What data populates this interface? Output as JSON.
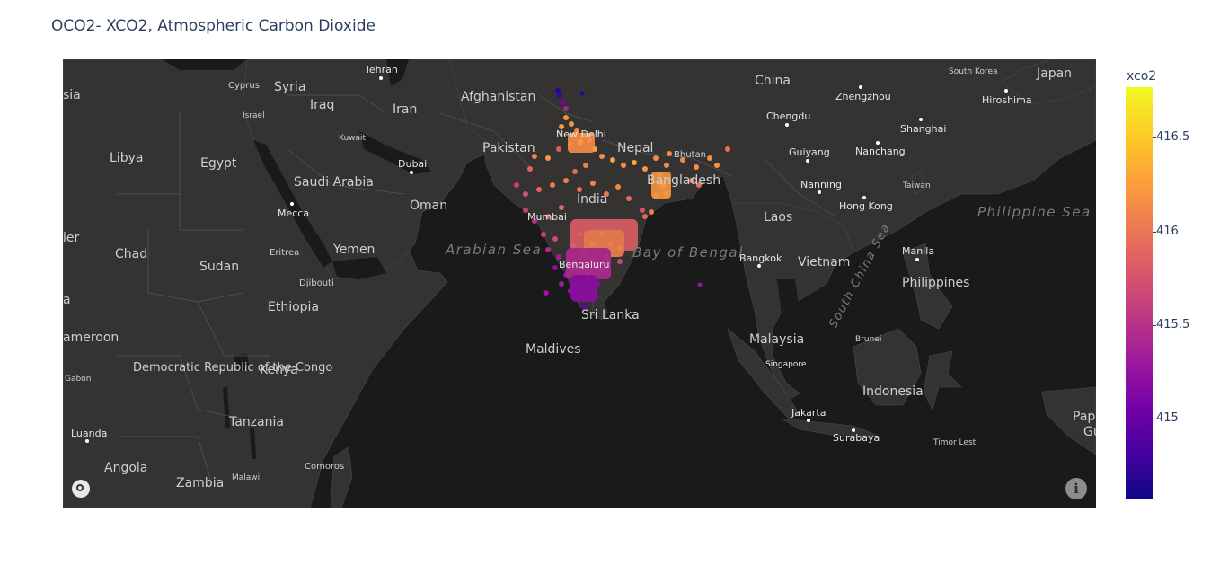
{
  "title": "OCO2- XCO2, Atmospheric Carbon Dioxide",
  "colorbar": {
    "title": "xco2",
    "ticks": [
      {
        "label": "416.5",
        "value": 416.5
      },
      {
        "label": "416",
        "value": 416.0
      },
      {
        "label": "415.5",
        "value": 415.5
      },
      {
        "label": "415",
        "value": 415.0
      }
    ],
    "range": [
      414.57,
      416.77
    ],
    "colorscale": [
      "#0d0887",
      "#46039f",
      "#7201a8",
      "#9c179e",
      "#bd3786",
      "#d8576b",
      "#ed7953",
      "#fb9f3a",
      "#fdca26",
      "#f0f921"
    ]
  },
  "map_labels": {
    "countries": [
      "Syria",
      "Iraq",
      "Iran",
      "Afghanistan",
      "Pakistan",
      "India",
      "Nepal",
      "Bhutan",
      "Bangladesh",
      "China",
      "Laos",
      "Vietnam",
      "Philippines",
      "Malaysia",
      "Indonesia",
      "Sri Lanka",
      "Maldives",
      "Oman",
      "Yemen",
      "Saudi Arabia",
      "Egypt",
      "Libya",
      "Chad",
      "Sudan",
      "Eritrea",
      "Djibouti",
      "Ethiopia",
      "Kenya",
      "Tanzania",
      "Democratic Republic of the Congo",
      "Gabon",
      "Angola",
      "Zambia",
      "Malawi",
      "Comoros",
      "Cyprus",
      "Israel",
      "Kuwait",
      "Japan",
      "South Korea",
      "Taiwan",
      "Brunei",
      "Timor Lest"
    ],
    "cities": [
      "Tehran",
      "Dubai",
      "Mecca",
      "New Delhi",
      "Mumbai",
      "Bengaluru",
      "Chengdu",
      "Guiyang",
      "Nanning",
      "Hong Kong",
      "Zhengzhou",
      "Nanchang",
      "Shanghai",
      "Hiroshima",
      "Bangkok",
      "Manila",
      "Singapore",
      "Jakarta",
      "Surabaya",
      "Luanda"
    ],
    "water": [
      "Arabian Sea",
      "Bay of Bengal",
      "Philippine Sea",
      "South China Sea"
    ],
    "edge_fragments": [
      "sia",
      "ier",
      "ameroon",
      "a",
      "Pap",
      "Gu"
    ]
  }
}
